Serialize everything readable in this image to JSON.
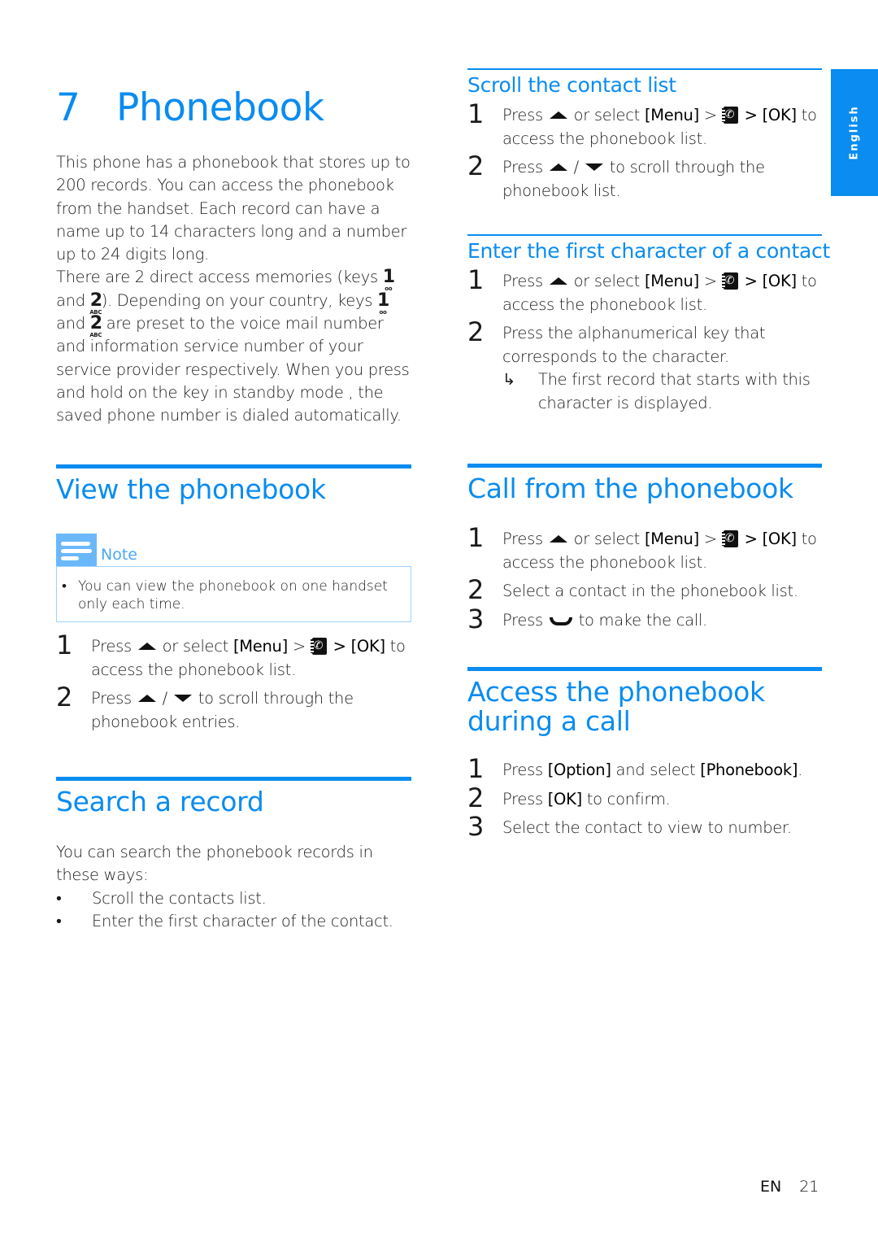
{
  "chapter": {
    "number": "7",
    "title": "Phonebook"
  },
  "language_tab": "English",
  "intro": {
    "p1": "This phone has a phonebook that stores up to 200 records. You can access the phonebook from the handset. Each record can have a name up to 14 characters long and a number up to 24 digits long.",
    "p2_parts": {
      "a": "There are 2 direct access memories (keys ",
      "b": "and ",
      "c": "). Depending on your country, keys ",
      "d": "and ",
      "e": " are preset to the voice mail number and information service number of your service provider respectively. When you press and hold on the key in standby mode , the saved phone number is dialed automatically."
    },
    "keys": {
      "key1": "1",
      "key1_sub": "oo",
      "key2": "2",
      "key2_sub": "ABC"
    }
  },
  "view_section": {
    "title": "View the phonebook",
    "note_label": "Note",
    "note_text": "You can view the phonebook on one handset only each time.",
    "steps": [
      {
        "n": "1",
        "pre": "Press",
        "mid": "or select",
        "menu": "[Menu]",
        "gt": ">",
        "ok": "> [OK]",
        "post": "to access the phonebook list."
      },
      {
        "n": "2",
        "pre": "Press",
        "sep": "/",
        "post": "to scroll through the phonebook entries."
      }
    ]
  },
  "search_section": {
    "title": "Search a record",
    "intro": "You can search the phonebook records in these ways:",
    "bullets": [
      "Scroll the contacts list.",
      "Enter the first character of the contact."
    ]
  },
  "scroll_section": {
    "title": "Scroll the contact list",
    "steps": [
      {
        "n": "1",
        "pre": "Press",
        "mid": "or select",
        "menu": "[Menu]",
        "gt": ">",
        "ok": "> [OK]",
        "post": "to access the phonebook list."
      },
      {
        "n": "2",
        "pre": "Press",
        "sep": "/",
        "post": "to scroll through the phonebook list."
      }
    ]
  },
  "enter_section": {
    "title": "Enter the first character of a contact",
    "steps": [
      {
        "n": "1",
        "pre": "Press",
        "mid": "or select",
        "menu": "[Menu]",
        "gt": ">",
        "ok": "> [OK]",
        "post": "to access the phonebook list."
      },
      {
        "n": "2",
        "text": "Press the alphanumerical key that corresponds to the character.",
        "result_arrow": "↳",
        "result": "The first record that starts with this character is displayed."
      }
    ]
  },
  "call_section": {
    "title": "Call from the phonebook",
    "steps": [
      {
        "n": "1",
        "pre": "Press",
        "mid": "or select",
        "menu": "[Menu]",
        "gt": ">",
        "ok": "> [OK]",
        "post": "to access the phonebook list."
      },
      {
        "n": "2",
        "text": "Select a contact in the phonebook list."
      },
      {
        "n": "3",
        "pre": "Press",
        "post": "to make the call."
      }
    ]
  },
  "during_call_section": {
    "title": "Access the phonebook during a call",
    "steps": [
      {
        "n": "1",
        "pre": "Press",
        "opt": "[Option]",
        "mid": "and select",
        "pb": "[Phonebook]",
        "end": "."
      },
      {
        "n": "2",
        "pre": "Press",
        "ok": "[OK]",
        "post": "to confirm."
      },
      {
        "n": "3",
        "text": "Select the contact to view to number."
      }
    ]
  },
  "footer": {
    "lang": "EN",
    "page": "21"
  }
}
